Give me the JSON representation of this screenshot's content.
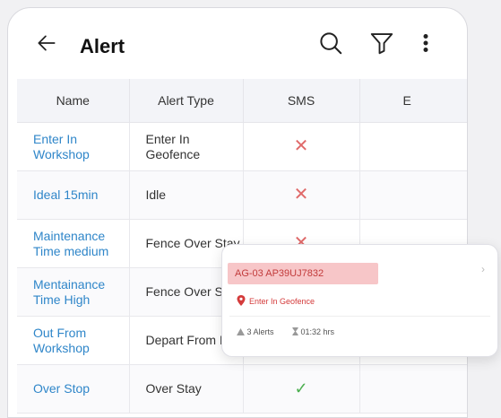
{
  "header": {
    "title": "Alert",
    "icons": [
      "back-arrow-icon",
      "search-icon",
      "filter-icon",
      "more-vertical-icon"
    ]
  },
  "table": {
    "columns": [
      "Name",
      "Alert Type",
      "SMS",
      "E"
    ],
    "rows": [
      {
        "name": "Enter In Workshop",
        "type": "Enter In Geofence",
        "sms": "✕"
      },
      {
        "name": "Ideal 15min",
        "type": "Idle",
        "sms": "✕"
      },
      {
        "name": "Maintenance Time medium",
        "type": "Fence Over Stay",
        "sms": "✕"
      },
      {
        "name": "Mentainance Time High",
        "type": "Fence Over Stay",
        "sms": ""
      },
      {
        "name": "Out From Workshop",
        "type": "Depart From POI",
        "sms": ""
      },
      {
        "name": "Over Stop",
        "type": "Over Stay",
        "sms": "✓"
      }
    ]
  },
  "card": {
    "registration": "AG-03 AP39UJ7832",
    "status": "Enter In Geofence",
    "alerts": "3 Alerts",
    "duration": "01:32 hrs",
    "chevron": "›"
  },
  "colors": {
    "link": "#2f86c9",
    "cross": "#e06a6a",
    "tick": "#4caf50",
    "badge_bg": "#f7c6c8",
    "badge_text": "#c23b3b"
  }
}
